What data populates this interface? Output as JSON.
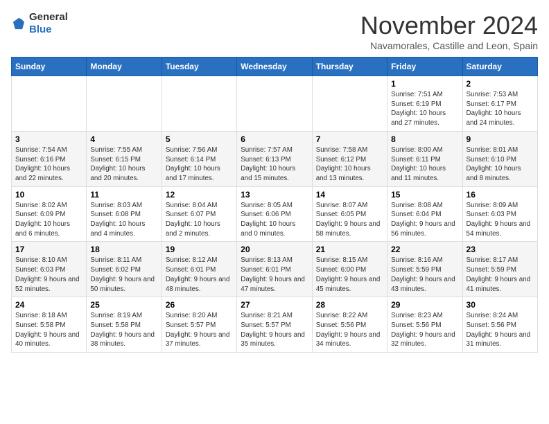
{
  "header": {
    "logo": {
      "general": "General",
      "blue": "Blue"
    },
    "month": "November 2024",
    "location": "Navamorales, Castille and Leon, Spain"
  },
  "weekdays": [
    "Sunday",
    "Monday",
    "Tuesday",
    "Wednesday",
    "Thursday",
    "Friday",
    "Saturday"
  ],
  "weeks": [
    [
      {
        "day": "",
        "info": ""
      },
      {
        "day": "",
        "info": ""
      },
      {
        "day": "",
        "info": ""
      },
      {
        "day": "",
        "info": ""
      },
      {
        "day": "",
        "info": ""
      },
      {
        "day": "1",
        "info": "Sunrise: 7:51 AM\nSunset: 6:19 PM\nDaylight: 10 hours and 27 minutes."
      },
      {
        "day": "2",
        "info": "Sunrise: 7:53 AM\nSunset: 6:17 PM\nDaylight: 10 hours and 24 minutes."
      }
    ],
    [
      {
        "day": "3",
        "info": "Sunrise: 7:54 AM\nSunset: 6:16 PM\nDaylight: 10 hours and 22 minutes."
      },
      {
        "day": "4",
        "info": "Sunrise: 7:55 AM\nSunset: 6:15 PM\nDaylight: 10 hours and 20 minutes."
      },
      {
        "day": "5",
        "info": "Sunrise: 7:56 AM\nSunset: 6:14 PM\nDaylight: 10 hours and 17 minutes."
      },
      {
        "day": "6",
        "info": "Sunrise: 7:57 AM\nSunset: 6:13 PM\nDaylight: 10 hours and 15 minutes."
      },
      {
        "day": "7",
        "info": "Sunrise: 7:58 AM\nSunset: 6:12 PM\nDaylight: 10 hours and 13 minutes."
      },
      {
        "day": "8",
        "info": "Sunrise: 8:00 AM\nSunset: 6:11 PM\nDaylight: 10 hours and 11 minutes."
      },
      {
        "day": "9",
        "info": "Sunrise: 8:01 AM\nSunset: 6:10 PM\nDaylight: 10 hours and 8 minutes."
      }
    ],
    [
      {
        "day": "10",
        "info": "Sunrise: 8:02 AM\nSunset: 6:09 PM\nDaylight: 10 hours and 6 minutes."
      },
      {
        "day": "11",
        "info": "Sunrise: 8:03 AM\nSunset: 6:08 PM\nDaylight: 10 hours and 4 minutes."
      },
      {
        "day": "12",
        "info": "Sunrise: 8:04 AM\nSunset: 6:07 PM\nDaylight: 10 hours and 2 minutes."
      },
      {
        "day": "13",
        "info": "Sunrise: 8:05 AM\nSunset: 6:06 PM\nDaylight: 10 hours and 0 minutes."
      },
      {
        "day": "14",
        "info": "Sunrise: 8:07 AM\nSunset: 6:05 PM\nDaylight: 9 hours and 58 minutes."
      },
      {
        "day": "15",
        "info": "Sunrise: 8:08 AM\nSunset: 6:04 PM\nDaylight: 9 hours and 56 minutes."
      },
      {
        "day": "16",
        "info": "Sunrise: 8:09 AM\nSunset: 6:03 PM\nDaylight: 9 hours and 54 minutes."
      }
    ],
    [
      {
        "day": "17",
        "info": "Sunrise: 8:10 AM\nSunset: 6:03 PM\nDaylight: 9 hours and 52 minutes."
      },
      {
        "day": "18",
        "info": "Sunrise: 8:11 AM\nSunset: 6:02 PM\nDaylight: 9 hours and 50 minutes."
      },
      {
        "day": "19",
        "info": "Sunrise: 8:12 AM\nSunset: 6:01 PM\nDaylight: 9 hours and 48 minutes."
      },
      {
        "day": "20",
        "info": "Sunrise: 8:13 AM\nSunset: 6:01 PM\nDaylight: 9 hours and 47 minutes."
      },
      {
        "day": "21",
        "info": "Sunrise: 8:15 AM\nSunset: 6:00 PM\nDaylight: 9 hours and 45 minutes."
      },
      {
        "day": "22",
        "info": "Sunrise: 8:16 AM\nSunset: 5:59 PM\nDaylight: 9 hours and 43 minutes."
      },
      {
        "day": "23",
        "info": "Sunrise: 8:17 AM\nSunset: 5:59 PM\nDaylight: 9 hours and 41 minutes."
      }
    ],
    [
      {
        "day": "24",
        "info": "Sunrise: 8:18 AM\nSunset: 5:58 PM\nDaylight: 9 hours and 40 minutes."
      },
      {
        "day": "25",
        "info": "Sunrise: 8:19 AM\nSunset: 5:58 PM\nDaylight: 9 hours and 38 minutes."
      },
      {
        "day": "26",
        "info": "Sunrise: 8:20 AM\nSunset: 5:57 PM\nDaylight: 9 hours and 37 minutes."
      },
      {
        "day": "27",
        "info": "Sunrise: 8:21 AM\nSunset: 5:57 PM\nDaylight: 9 hours and 35 minutes."
      },
      {
        "day": "28",
        "info": "Sunrise: 8:22 AM\nSunset: 5:56 PM\nDaylight: 9 hours and 34 minutes."
      },
      {
        "day": "29",
        "info": "Sunrise: 8:23 AM\nSunset: 5:56 PM\nDaylight: 9 hours and 32 minutes."
      },
      {
        "day": "30",
        "info": "Sunrise: 8:24 AM\nSunset: 5:56 PM\nDaylight: 9 hours and 31 minutes."
      }
    ]
  ]
}
